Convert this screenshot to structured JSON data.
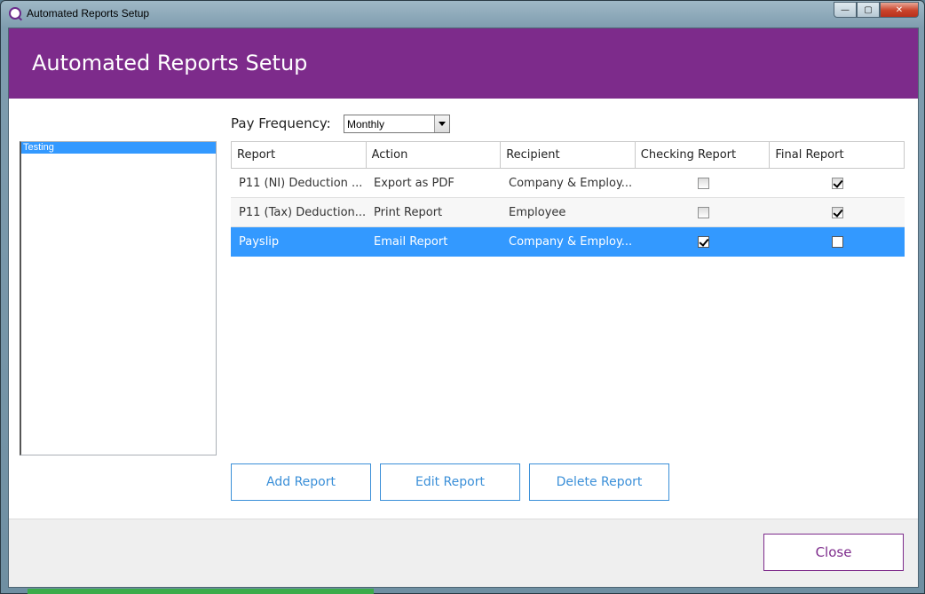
{
  "window": {
    "title": "Automated Reports Setup",
    "minimize_glyph": "—",
    "maximize_glyph": "▢",
    "close_glyph": "✕"
  },
  "header": {
    "title": "Automated Reports Setup"
  },
  "left_list": {
    "items": [
      "Testing"
    ]
  },
  "pay_frequency": {
    "label": "Pay Frequency:",
    "value": "Monthly"
  },
  "grid": {
    "columns": [
      "Report",
      "Action",
      "Recipient",
      "Checking Report",
      "Final Report"
    ],
    "rows": [
      {
        "report": "P11 (NI) Deduction ...",
        "action": "Export as PDF",
        "recipient": "Company & Employ...",
        "checking": false,
        "final": true
      },
      {
        "report": "P11 (Tax) Deduction...",
        "action": "Print Report",
        "recipient": "Employee",
        "checking": false,
        "final": true
      },
      {
        "report": "Payslip",
        "action": "Email Report",
        "recipient": "Company & Employ...",
        "checking": true,
        "final": false
      }
    ]
  },
  "buttons": {
    "add": "Add Report",
    "edit": "Edit Report",
    "delete": "Delete Report",
    "close": "Close"
  },
  "colors": {
    "header": "#7d2b8b",
    "selection": "#3399ff",
    "action_button": "#3a8fd8"
  }
}
